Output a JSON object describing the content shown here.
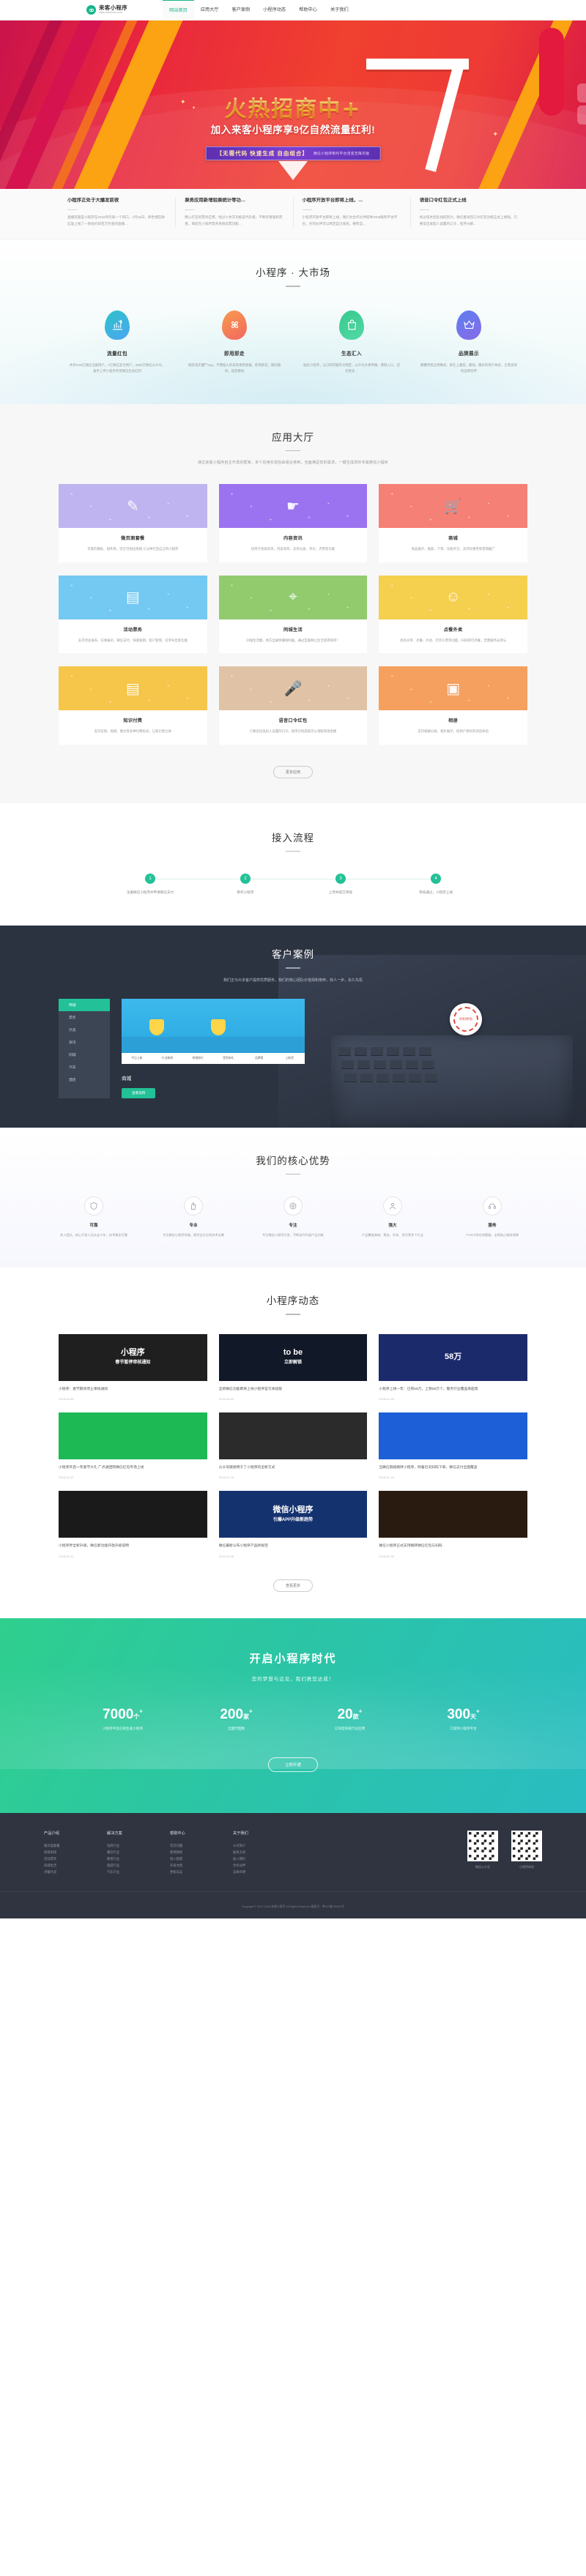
{
  "header": {
    "logo_name": "来客小程序",
    "logo_url": "www.laikecms.com",
    "nav": [
      {
        "label": "网站首页",
        "active": true
      },
      {
        "label": "应用大厅",
        "active": false
      },
      {
        "label": "客户案例",
        "active": false
      },
      {
        "label": "小程序动态",
        "active": false
      },
      {
        "label": "帮助中心",
        "active": false
      },
      {
        "label": "关于我们",
        "active": false
      }
    ]
  },
  "banner": {
    "title": "火热招商中+",
    "subtitle": "加入来客小程序享9亿自然流量红利!",
    "badge_main": "【无需代码 快速生成 自由组合】",
    "badge_note": "微信小程序制作平台百变无限可能"
  },
  "news_bar": [
    {
      "title": "小程序正处于大爆发前夜",
      "desc": "直播答题是小程序在2018年的第一个风口。1月18日，新世相在微信里上线了一款估价四百万奖金的直播…"
    },
    {
      "title": "票务应用新增验票统计等功…",
      "desc": "精心打造的票务应用，经过十余次功能迭代升级，不断的增强和完善。目前在小程序票务系统验票功能…"
    },
    {
      "title": "小程序开放平台即将上线，…",
      "desc": "小程序开放平台即将上线，我们为合作伙伴提供OEM版和平台平台，合作伙伴可以绑定自己域名，拥有自…"
    },
    {
      "title": "语音口令红包正式上线",
      "desc": "经过技术团队加班努力，微信版语音口令红包功能正式上线啦，只要说出发起人设置的口令，程序分解…"
    }
  ],
  "market": {
    "title": "小程序 · 大市场",
    "items": [
      {
        "icon": "chart-growth-icon",
        "name": "流量红包",
        "desc": "共享9.85亿微信注册用户，7亿微信支付用户，2000万微信公众号，垂手上传小程序享受微信生态红利"
      },
      {
        "icon": "puzzle-icon",
        "name": "即用即走",
        "desc": "彻底消灭僵尸App，不需恼人的安装更新卸载，即用即走，随扫随效，就是要快"
      },
      {
        "icon": "shopping-bag-icon",
        "name": "生态汇入",
        "desc": "贴近小程序，与订阅可服务号绑定，公众号文章传播，增值入口，还有更多…"
      },
      {
        "icon": "crown-icon",
        "name": "品牌展示",
        "desc": "颠覆传统应用模式，即在上载轻、最快，最好的用户体验，全景高效的品牌宣传"
      }
    ]
  },
  "hall": {
    "title": "应用大厅",
    "desc": "通过来客小程序自主开发的框架，多个应用实现自由组合使用，全面满足您的需求，一键生成您的专属微信小程序",
    "more_label": "更多应用",
    "apps": [
      {
        "name": "微页面套餐",
        "desc": "丰富的模板、组件库，完全可视化拖拽 三分钟打造自己的小程序",
        "color": "#bfb4f0",
        "glyph": "✎",
        "icon": "page-edit-icon"
      },
      {
        "name": "内容资讯",
        "desc": "适用于各类资讯、内容发布，支持分类、评论、点赞等功能",
        "color": "#9b73f0",
        "glyph": "☛",
        "icon": "thumb-up-icon"
      },
      {
        "name": "商城",
        "desc": "商品展示、搜索、下单、功能齐全，支持优惠券等营销推广",
        "color": "#f58076",
        "glyph": "🛒",
        "icon": "cart-icon"
      },
      {
        "name": "活动票务",
        "desc": "支持活动发布、在线报名、微信支付、快速核销、客户管理、名单导出等功能",
        "color": "#74c9f2",
        "glyph": "▤",
        "icon": "ticket-icon"
      },
      {
        "name": "同城生活",
        "desc": "同城生活圈，地方自媒体赚钱利器，通过互联网让生活变得简单！",
        "color": "#91cb6e",
        "glyph": "⌖",
        "icon": "location-icon"
      },
      {
        "name": "点餐外卖",
        "desc": "具有买单、点餐、外卖、打印小票等功能，扫码即可点餐，无需服务员参与",
        "color": "#f5cf4e",
        "glyph": "☺",
        "icon": "meal-icon"
      },
      {
        "name": "知识付费",
        "desc": "支持音频、视频、图文等多种付费形式，让知识更立体",
        "color": "#f5c64a",
        "glyph": "▤",
        "icon": "book-icon"
      },
      {
        "name": "语音口令红包",
        "desc": "只要说出发起人设置的口令，程序识别后就可以领取到现金额",
        "color": "#e0c3a6",
        "glyph": "🎤",
        "icon": "microphone-icon"
      },
      {
        "name": "相册",
        "desc": "支持相册分类、相片展示，给用户更好的浏览体验",
        "color": "#f5a05e",
        "glyph": "▣",
        "icon": "photo-icon"
      }
    ]
  },
  "flow": {
    "title": "接入流程",
    "steps": [
      {
        "num": "1",
        "label": "注册微信小程序并申请微信支付"
      },
      {
        "num": "2",
        "label": "制作小程序"
      },
      {
        "num": "3",
        "label": "上传并提交审核"
      },
      {
        "num": "4",
        "label": "审核通过，小程序上线"
      }
    ]
  },
  "cases": {
    "title": "客户案例",
    "desc": "我们正为众多客户提供优质服务，我们的核心团队价值观和使命，快人一步，永久先机",
    "menu": [
      {
        "label": "商城",
        "active": true
      },
      {
        "label": "票务",
        "active": false
      },
      {
        "label": "外卖",
        "active": false
      },
      {
        "label": "资讯",
        "active": false
      },
      {
        "label": "同城",
        "active": false
      },
      {
        "label": "汽车",
        "active": false
      },
      {
        "label": "酒店",
        "active": false
      }
    ],
    "shot_tabs": [
      "今日上新",
      "行业新闻",
      "热销排行",
      "签到有礼",
      "品牌馆",
      "上新货"
    ],
    "case_name": "商城",
    "case_btn": "查看案例",
    "badge_text": "扫码体验"
  },
  "advantage": {
    "title": "我们的核心优势",
    "items": [
      {
        "icon": "shield-icon",
        "name": "可靠",
        "desc": "多人团队，核心开发人员从业十年，技术稳定可靠"
      },
      {
        "icon": "thumb-icon",
        "name": "专业",
        "desc": "专注微信小程序领域，提供全方位的技术支撑"
      },
      {
        "icon": "target-icon",
        "name": "专注",
        "desc": "专注微信小程序开发，不断迭代升级产品功能"
      },
      {
        "icon": "user-icon",
        "name": "强大",
        "desc": "产品覆盖商城、票务、外卖、资讯等多个行业"
      },
      {
        "icon": "service-icon",
        "name": "服务",
        "desc": "7×24小时在线客服，全程贴心服务保障"
      }
    ]
  },
  "news_section": {
    "title": "小程序动态",
    "more_label": "查看更多",
    "cards": [
      {
        "headline": "小程序",
        "sub": "春节暂停审核通知",
        "color": "#1f1f1f",
        "title": "小程序：春节期间停止审核通知",
        "date": "2018-02-05"
      },
      {
        "headline": "to be",
        "sub": "立即解锁",
        "color": "#111827",
        "title": "全新微信功能即将上线小程序官方体验版",
        "date": "2018-02-02"
      },
      {
        "headline": "58万",
        "sub": "",
        "color": "#1b2a6b",
        "title": "小程序上线一年：已有58万，上架58万个，服务行业覆盖率超高",
        "date": "2018-01-28"
      },
      {
        "headline": "",
        "sub": "",
        "color": "#1db954",
        "title": "小程序开启一年春节大礼 广点通团购微信红包专场上线",
        "date": "2018-01-20"
      },
      {
        "headline": "",
        "sub": "",
        "color": "#2b2b2b",
        "title": "公众号链接用于了小程序的全新方式",
        "date": "2018-01-18"
      },
      {
        "headline": "",
        "sub": "",
        "color": "#1c5fd6",
        "title": "当微信链接跳转小程序，附着近况扫码下单，微信支付全面覆盖",
        "date": "2018-01-15"
      },
      {
        "headline": "",
        "sub": "",
        "color": "#1a1a1a",
        "title": "小程序界全新升级，微信新功能开放升级说明",
        "date": "2018-01-10"
      },
      {
        "headline": "微信小程序",
        "sub": "引爆APP升级新趋势",
        "color": "#14326e",
        "title": "微信最新公布小程序产品新规范",
        "date": "2018-01-08"
      },
      {
        "headline": "",
        "sub": "",
        "color": "#2a1b10",
        "title": "微信小程序正式支持跳转微信红包与扫码",
        "date": "2018-01-05"
      }
    ]
  },
  "cta": {
    "title": "开启小程序时代",
    "subtitle": "您的梦想与远见，我们携您达成！",
    "stats": [
      {
        "num": "7000",
        "unit": "个",
        "sup": "+",
        "label": "小程序平台已经生成小程序"
      },
      {
        "num": "200",
        "unit": "家",
        "sup": "+",
        "label": "全国代理数"
      },
      {
        "num": "20",
        "unit": "款",
        "sup": "+",
        "label": "已深度研发行业应用"
      },
      {
        "num": "300",
        "unit": "天",
        "sup": "+",
        "label": "工程师小程序平台"
      }
    ],
    "button_label": "立即开通"
  },
  "footer": {
    "columns": [
      {
        "heading": "产品介绍",
        "links": [
          "微页面套餐",
          "商城系统",
          "活动票务",
          "同城生活",
          "点餐外卖"
        ]
      },
      {
        "heading": "解决方案",
        "links": [
          "电商行业",
          "餐饮行业",
          "教育行业",
          "旅游行业",
          "汽车行业"
        ]
      },
      {
        "heading": "帮助中心",
        "links": [
          "常见问题",
          "使用教程",
          "接入指南",
          "开发文档",
          "更新日志"
        ]
      },
      {
        "heading": "关于我们",
        "links": [
          "公司简介",
          "联系方式",
          "加入我们",
          "合作伙伴",
          "法律声明"
        ]
      }
    ],
    "qrcodes": [
      {
        "caption": "微信公众号"
      },
      {
        "caption": "小程序体验"
      }
    ],
    "copyright": "Copyright © 2017-2018 来客小程序 All Rights Reserved  备案号：粤ICP备000000号"
  }
}
